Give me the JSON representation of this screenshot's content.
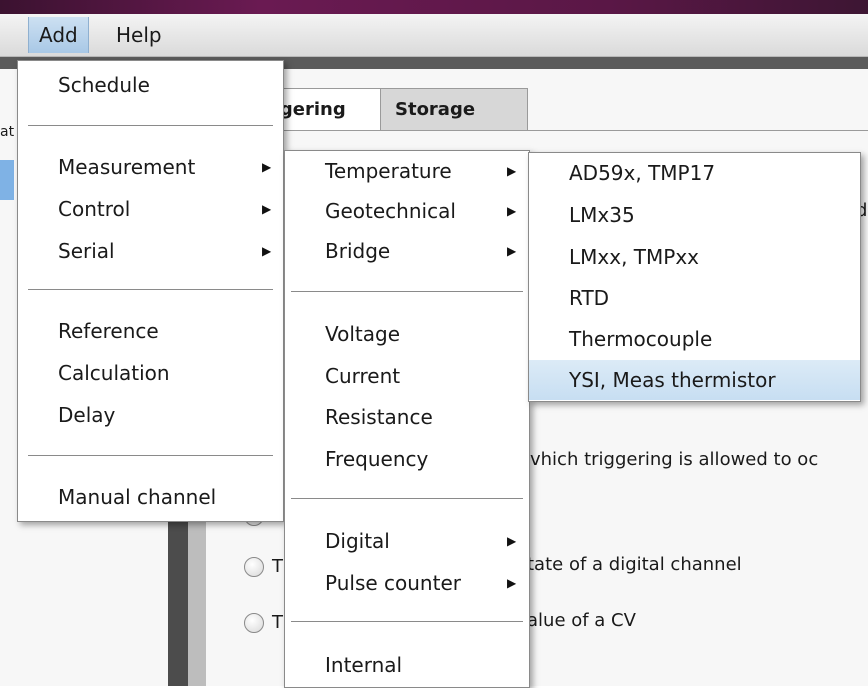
{
  "menubar": {
    "items": [
      {
        "label": "Add"
      },
      {
        "label": "Help"
      }
    ]
  },
  "background": {
    "tabs": [
      {
        "label": "ggering"
      },
      {
        "label": "Storage"
      }
    ],
    "fragments": {
      "left_at": "at",
      "right_d": "d",
      "trigger_text": "vhich triggering is allowed to oc",
      "digital_text": "tate of a digital channel",
      "cv_text": "alue of a CV",
      "t1": "T",
      "t2": "T"
    }
  },
  "add_menu": {
    "items": [
      {
        "label": "Schedule"
      },
      {
        "label": "Measurement"
      },
      {
        "label": "Control"
      },
      {
        "label": "Serial"
      },
      {
        "label": "Reference"
      },
      {
        "label": "Calculation"
      },
      {
        "label": "Delay"
      },
      {
        "label": "Manual channel"
      }
    ]
  },
  "measurement_menu": {
    "items": [
      {
        "label": "Temperature"
      },
      {
        "label": "Geotechnical"
      },
      {
        "label": "Bridge"
      },
      {
        "label": "Voltage"
      },
      {
        "label": "Current"
      },
      {
        "label": "Resistance"
      },
      {
        "label": "Frequency"
      },
      {
        "label": "Digital"
      },
      {
        "label": "Pulse counter"
      },
      {
        "label": "Internal"
      }
    ]
  },
  "temperature_menu": {
    "items": [
      {
        "label": "AD59x, TMP17"
      },
      {
        "label": "LMx35"
      },
      {
        "label": "LMxx, TMPxx"
      },
      {
        "label": "RTD"
      },
      {
        "label": "Thermocouple"
      },
      {
        "label": "YSI, Meas thermistor"
      }
    ],
    "highlighted": "YSI, Meas thermistor"
  },
  "icons": {
    "submenu_arrow": "triangle-right-icon",
    "radio": "radio-button"
  },
  "colors": {
    "highlight": "#c7def2",
    "menubar_active": "#a9c8e6",
    "title_strip": "#6a1a52"
  }
}
